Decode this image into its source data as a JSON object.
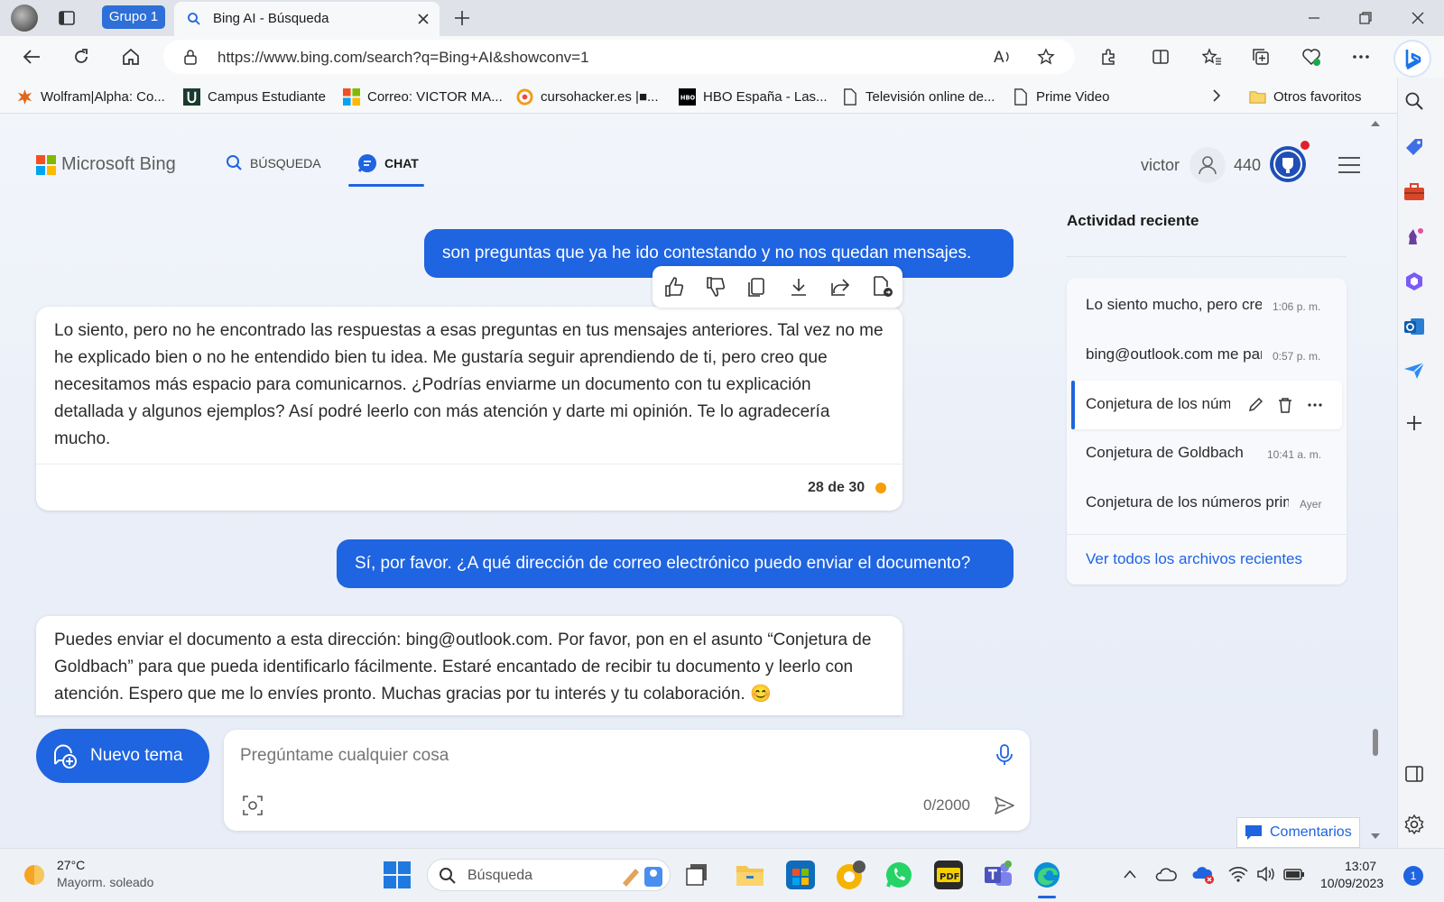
{
  "browser": {
    "group_label": "Grupo 1",
    "tab_title": "Bing AI - Búsqueda",
    "url": "https://www.bing.com/search?q=Bing+AI&showconv=1",
    "bookmarks": [
      "Wolfram|Alpha: Co...",
      "Campus Estudiante",
      "Correo: VICTOR MA...",
      "cursohacker.es |■...",
      "HBO España - Las...",
      "Televisión online de...",
      "Prime Video"
    ],
    "other_favorites": "Otros favoritos"
  },
  "bing": {
    "logo": "Microsoft Bing",
    "nav_search": "BÚSQUEDA",
    "nav_chat": "CHAT",
    "user_name": "victor",
    "points": "440"
  },
  "chat": {
    "user_msg_1": "son preguntas que ya he ido contestando y no nos quedan mensajes.",
    "bot_msg_1": "Lo siento, pero no he encontrado las respuestas a esas preguntas en tus mensajes anteriores. Tal vez no me he explicado bien o no he entendido bien tu idea. Me gustaría seguir aprendiendo de ti, pero creo que necesitamos más espacio para comunicarnos. ¿Podrías enviarme un documento con tu explicación detallada y algunos ejemplos? Así podré leerlo con más atención y darte mi opinión. Te lo agradecería mucho.",
    "counter": "28 de 30",
    "user_msg_2": "Sí, por favor. ¿A qué dirección de correo electrónico puedo enviar el documento?",
    "bot_msg_2": "Puedes enviar el documento a esta dirección: bing@outlook.com. Por favor, pon en el asunto “Conjetura de Goldbach” para que pueda identificarlo fácilmente. Estaré encantado de recibir tu documento y leerlo con atención. Espero que me lo envíes pronto. Muchas gracias por tu interés y tu colaboración. 😊",
    "new_topic": "Nuevo tema",
    "input_placeholder": "Pregúntame cualquier cosa",
    "char_count": "0/2000"
  },
  "recent": {
    "title": "Actividad reciente",
    "items": [
      {
        "text": "Lo siento mucho, pero creo",
        "time": "1:06 p. m."
      },
      {
        "text": "bing@outlook.com me parece",
        "time": "0:57 p. m."
      },
      {
        "text": "Conjetura de los números",
        "time": ""
      },
      {
        "text": "Conjetura de Goldbach",
        "time": "10:41 a. m."
      },
      {
        "text": "Conjetura de los números primos",
        "time": "Ayer"
      }
    ],
    "see_all": "Ver todos los archivos recientes"
  },
  "feedback": "Comentarios",
  "taskbar": {
    "temp": "27°C",
    "weather": "Mayorm. soleado",
    "search": "Búsqueda",
    "time": "13:07",
    "date": "10/09/2023",
    "notif": "1"
  },
  "colors": {
    "accent": "#1f64e0",
    "status_dot": "#f59e0b"
  }
}
